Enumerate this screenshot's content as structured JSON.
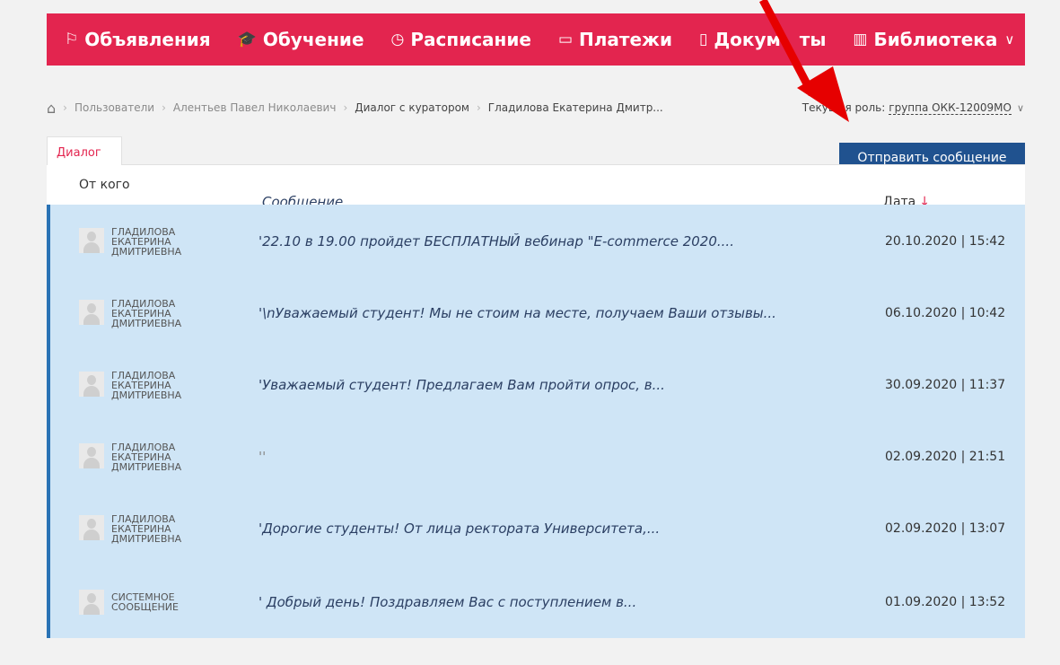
{
  "nav": {
    "items": [
      {
        "label": "Объявления",
        "icon": "flag-icon",
        "glyph": "⚐"
      },
      {
        "label": "Обучение",
        "icon": "graduation-cap-icon",
        "glyph": "🎓"
      },
      {
        "label": "Расписание",
        "icon": "clock-icon",
        "glyph": "◷"
      },
      {
        "label": "Платежи",
        "icon": "payment-icon",
        "glyph": "▭"
      },
      {
        "label": "Докум   ты",
        "icon": "document-icon",
        "glyph": "▯"
      },
      {
        "label": "Библиотека",
        "icon": "library-icon",
        "glyph": "▥"
      }
    ],
    "more_chevron": "∨",
    "color": "#e3254f"
  },
  "breadcrumb": {
    "home_icon": "home-icon",
    "home_glyph": "⌂",
    "separator": "›",
    "items": [
      "Пользователи",
      "Алентьев Павел Николаевич",
      "Диалог с куратором",
      "Гладилова Екатерина Дмитр..."
    ]
  },
  "role": {
    "label": "Текущая роль:",
    "value": "группа ОКК-12009МО",
    "chevron": "∨"
  },
  "send_button": {
    "label": "Отправить сообщение",
    "color": "#20528f"
  },
  "tabs": [
    {
      "label": "Диалог"
    }
  ],
  "table": {
    "headers": {
      "from": "От кого",
      "message": "Сообщение",
      "date": "Дата",
      "sort_icon": "↓"
    },
    "rows": [
      {
        "sender": "ГЛАДИЛОВА ЕКАТЕРИНА ДМИТРИЕВНА",
        "message": "'22.10 в 19.00 пройдет БЕСПЛАТНЫЙ вебинар \"E-commerce 2020....",
        "date": "20.10.2020 | 15:42"
      },
      {
        "sender": "ГЛАДИЛОВА ЕКАТЕРИНА ДМИТРИЕВНА",
        "message": "'\\nУважаемый студент! Мы не стоим на месте, получаем Ваши отзывы...",
        "date": "06.10.2020 | 10:42"
      },
      {
        "sender": "ГЛАДИЛОВА ЕКАТЕРИНА ДМИТРИЕВНА",
        "message": "'Уважаемый студент! Предлагаем Вам пройти опрос, в...",
        "date": "30.09.2020 | 11:37"
      },
      {
        "sender": "ГЛАДИЛОВА ЕКАТЕРИНА ДМИТРИЕВНА",
        "message": "''",
        "date": "02.09.2020 | 21:51"
      },
      {
        "sender": "ГЛАДИЛОВА ЕКАТЕРИНА ДМИТРИЕВНА",
        "message": "'Дорогие студенты! От лица ректората Университета,...",
        "date": "02.09.2020 | 13:07"
      },
      {
        "sender": "СИСТЕМНОЕ СООБЩЕНИЕ",
        "message": "' Добрый день! Поздравляем Вас с поступлением в...",
        "date": "01.09.2020 | 13:52"
      }
    ],
    "row_color": "#cfe5f6",
    "accent_color": "#2a73b5"
  },
  "annotation": {
    "icon": "red-arrow-annotation",
    "color": "#e60000"
  }
}
